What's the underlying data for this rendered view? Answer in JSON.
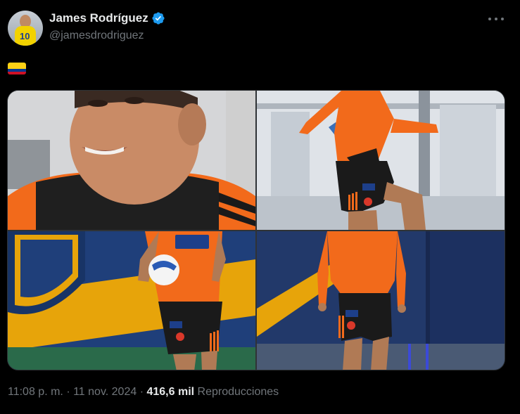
{
  "author": {
    "display_name": "James Rodríguez",
    "handle": "@jamesdrodriguez",
    "avatar_jersey_number": "10",
    "verified_color": "#1d9bf0"
  },
  "tweet": {
    "flag_emoji": "colombia-flag",
    "media_count": 4
  },
  "meta": {
    "time": "11:08 p. m.",
    "separator1": "·",
    "date": "11 nov. 2024",
    "separator2": "·",
    "views_count": "416,6 mil",
    "views_label": "Reproducciones"
  },
  "colors": {
    "background": "#000000",
    "text_primary": "#e7e9ea",
    "text_secondary": "#71767b",
    "jersey_orange": "#f26a1b",
    "shorts_black": "#1a1a1a",
    "boca_blue": "#1f3f7a",
    "boca_gold": "#f2b705"
  },
  "icons": [
    "verified-badge-icon",
    "more-icon",
    "colombia-flag-icon"
  ]
}
